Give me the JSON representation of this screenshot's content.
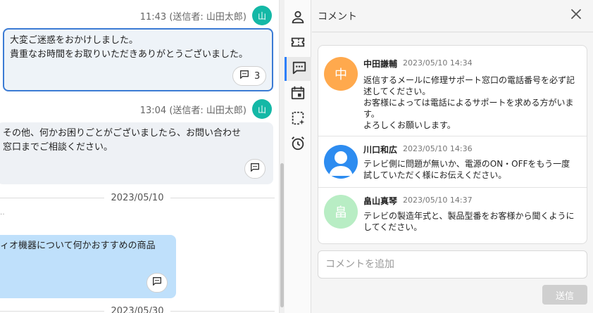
{
  "chat": {
    "messages": [
      {
        "meta": "11:43 (送信者: 山田太郎)",
        "avatar": "山",
        "lines": [
          "大変ご迷惑をおかけしました。",
          "貴重なお時間をお取りいただきありがとうございました。"
        ],
        "comment_count": "3"
      },
      {
        "meta": "13:04 (送信者: 山田太郎)",
        "avatar": "山",
        "lines": [
          "その他、何かお困りごとがございましたら、お問い合わせ",
          "窓口までご相談ください。"
        ]
      },
      {
        "lines": [
          "ィオ機器について何かおすすめの商品"
        ]
      }
    ],
    "dates": [
      "2023/05/10",
      "2023/05/30"
    ],
    "partial_char": "‥"
  },
  "rail": {
    "items": [
      {
        "icon": "person-icon"
      },
      {
        "icon": "ticket-icon"
      },
      {
        "icon": "comment-icon",
        "active": true
      },
      {
        "icon": "calendar-icon"
      },
      {
        "icon": "sparkle-note-icon"
      },
      {
        "icon": "alarm-icon"
      }
    ]
  },
  "panel": {
    "title": "コメント",
    "comments": [
      {
        "avatar": "中",
        "avatar_color": "#ffa94d",
        "name": "中田謙輔",
        "time": "2023/05/10 14:34",
        "body": "返信するメールに修理サポート窓口の電話番号を必ず記\n述してください。\nお客様によっては電話によるサポートを求める方がいま\nす。\nよろしくお願いします。"
      },
      {
        "avatar": "",
        "avatar_color": "#2d8cf0",
        "name": "川口和広",
        "time": "2023/05/10 14:36",
        "body": "テレビ側に問題が無いか、電源のON・OFFをもう一度\n試していただく様にお伝えください。"
      },
      {
        "avatar": "畠",
        "avatar_color": "#b8edc4",
        "name": "畠山真琴",
        "time": "2023/05/10 14:37",
        "body": "テレビの製造年式と、製品型番をお客様から聞くように\nしてください。"
      }
    ],
    "input_placeholder": "コメントを追加",
    "send_label": "送信"
  }
}
